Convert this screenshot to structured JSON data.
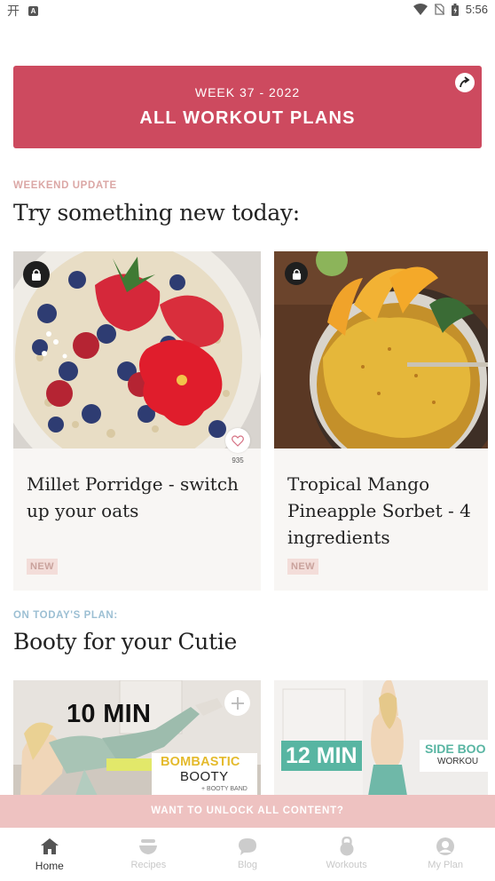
{
  "status_bar": {
    "time": "5:56",
    "icons": [
      "app-indicator-icon",
      "a-badge-icon",
      "wifi-icon",
      "no-sim-icon",
      "battery-icon"
    ]
  },
  "banner": {
    "week": "WEEK 37 - 2022",
    "title": "ALL WORKOUT PLANS",
    "color": "#cd4a5f"
  },
  "weekend_update": {
    "eyebrow": "WEEKEND UPDATE",
    "heading": "Try something new today:",
    "cards": [
      {
        "title": "Millet Porridge - switch up your oats",
        "badge": "NEW",
        "likes": "935",
        "locked": true
      },
      {
        "title": "Tropical Mango Pineapple Sorbet - 4 ingredients",
        "badge": "NEW",
        "locked": true
      }
    ]
  },
  "todays_plan": {
    "eyebrow": "ON TODAY'S PLAN:",
    "heading": "Booty for your Cutie",
    "workouts": [
      {
        "duration": "10 MIN",
        "tag_line1": "BOMBASTIC",
        "tag_line2": "BOOTY",
        "tag_line3": "+ BOOTY BAND"
      },
      {
        "duration": "12 MIN",
        "tag_line1": "SIDE BOO",
        "tag_line2": "WORKOU"
      }
    ]
  },
  "unlock_bar": {
    "label": "WANT TO UNLOCK ALL CONTENT?",
    "color": "#eec2c1"
  },
  "bottom_nav": {
    "items": [
      {
        "label": "Home",
        "icon": "home-icon",
        "active": true
      },
      {
        "label": "Recipes",
        "icon": "bowl-icon",
        "active": false
      },
      {
        "label": "Blog",
        "icon": "chat-bubble-icon",
        "active": false
      },
      {
        "label": "Workouts",
        "icon": "kettlebell-icon",
        "active": false
      },
      {
        "label": "My Plan",
        "icon": "profile-icon",
        "active": false
      }
    ]
  }
}
